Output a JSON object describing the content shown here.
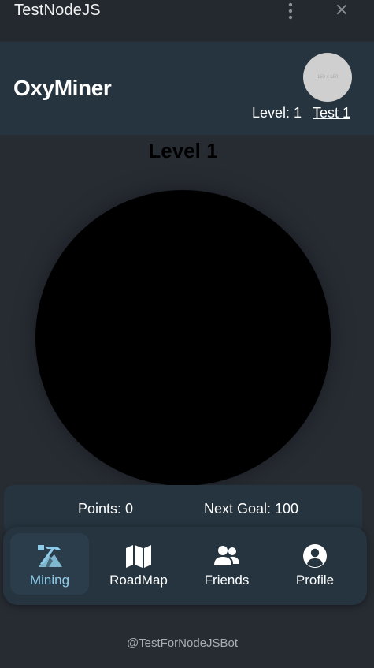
{
  "window": {
    "title": "TestNodeJS",
    "menu_icon": "more-vertical-icon",
    "close_icon": "close-icon",
    "close_glyph": "×"
  },
  "header": {
    "brand": "OxyMiner",
    "avatar_placeholder": "150 x 150",
    "level": "Level: 1",
    "username": "Test 1"
  },
  "main": {
    "level_heading": "Level 1"
  },
  "stats": {
    "points": "Points: 0",
    "next_goal": "Next Goal: 100"
  },
  "nav": {
    "items": [
      {
        "label": "Mining",
        "icon": "pickaxe-icon",
        "active": true
      },
      {
        "label": "RoadMap",
        "icon": "map-icon",
        "active": false
      },
      {
        "label": "Friends",
        "icon": "users-icon",
        "active": false
      },
      {
        "label": "Profile",
        "icon": "user-circle-icon",
        "active": false
      }
    ]
  },
  "footer": {
    "handle": "@TestForNodeJSBot"
  },
  "colors": {
    "background": "#272c33",
    "panel": "#25343f",
    "active_accent": "#8fcbe8",
    "text": "#ffffff"
  }
}
